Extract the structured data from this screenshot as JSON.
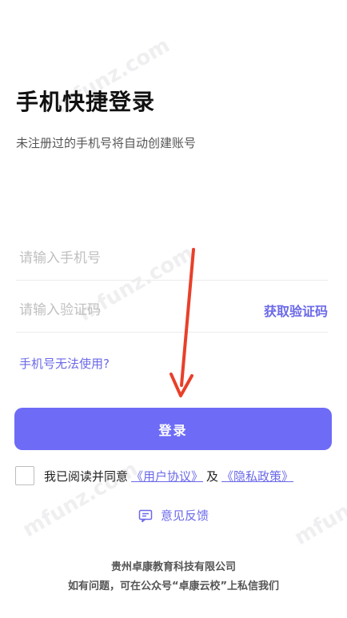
{
  "header": {
    "title": "手机快捷登录",
    "subtitle": "未注册过的手机号将自动创建账号"
  },
  "form": {
    "phone_placeholder": "请输入手机号",
    "code_placeholder": "请输入验证码",
    "get_code_label": "获取验证码",
    "phone_issue_label": "手机号无法使用?",
    "login_label": "登录"
  },
  "agreement": {
    "prefix": "我已阅读并同意",
    "user_agreement": "《用户协议》",
    "conjunction": "及",
    "privacy_policy": "《隐私政策》"
  },
  "feedback": {
    "label": "意见反馈"
  },
  "footer": {
    "company": "贵州卓康教育科技有限公司",
    "contact": "如有问题，可在公众号“卓康云校”上私信我们"
  },
  "watermark": "mfunz.com",
  "colors": {
    "accent": "#6b69e8",
    "button": "#6e6cf6",
    "arrow": "#e8402a"
  }
}
